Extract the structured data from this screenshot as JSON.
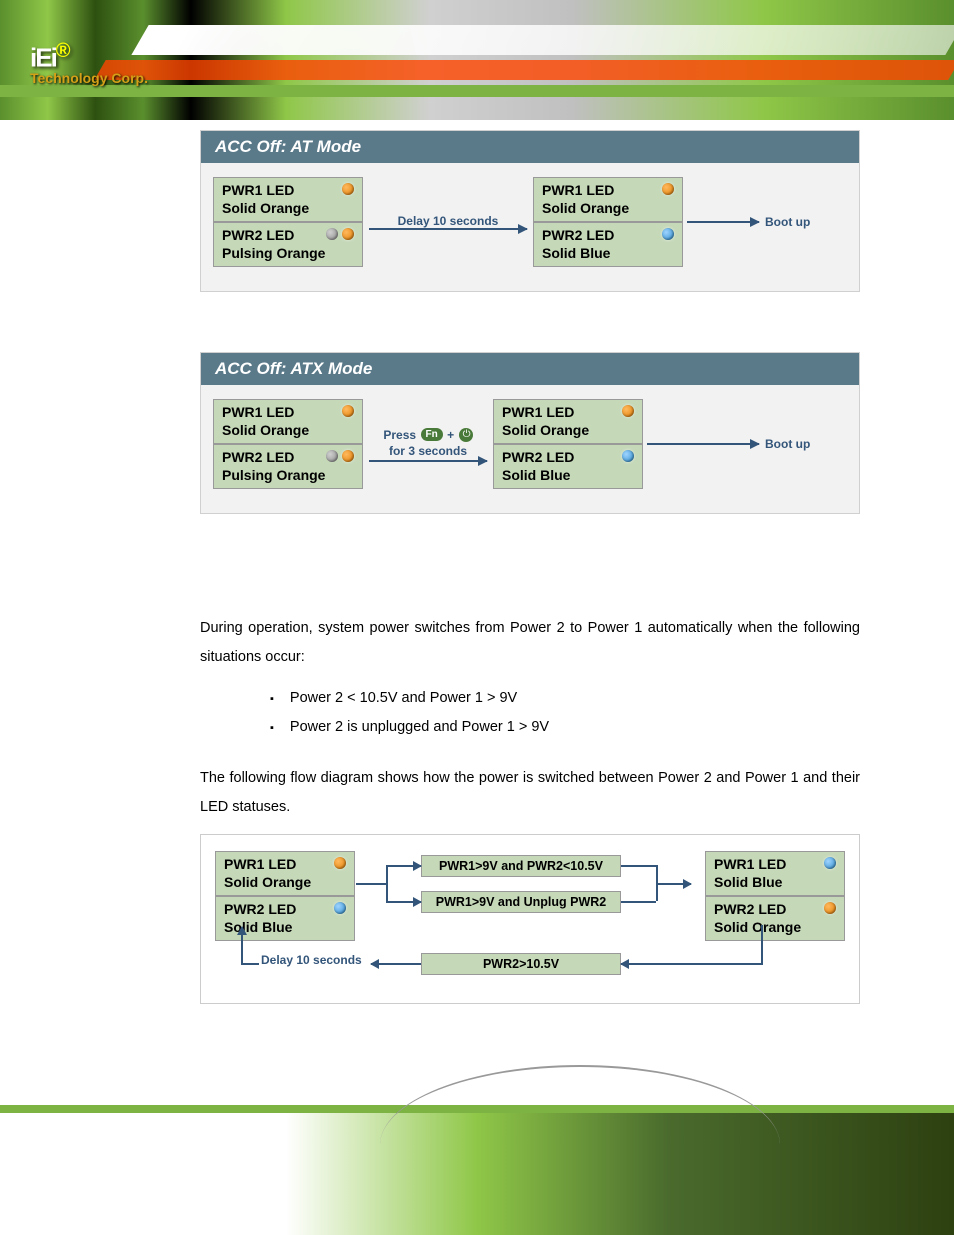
{
  "logo": {
    "main": "iEi",
    "reg": "®",
    "sub": "Technology Corp."
  },
  "diagram1": {
    "title": "ACC Off: AT Mode",
    "left": {
      "row1": "PWR1 LED\nSolid Orange",
      "row2": "PWR2 LED\nPulsing Orange"
    },
    "mid": "Delay 10 seconds",
    "right": {
      "row1": "PWR1 LED\nSolid Orange",
      "row2": "PWR2 LED\nSolid Blue"
    },
    "boot": "Boot up"
  },
  "diagram2": {
    "title": "ACC Off: ATX Mode",
    "left": {
      "row1": "PWR1 LED\nSolid Orange",
      "row2": "PWR2 LED\nPulsing Orange"
    },
    "mid_top": "Press",
    "fn": "Fn",
    "mid_bot": "for 3 seconds",
    "right": {
      "row1": "PWR1 LED\nSolid Orange",
      "row2": "PWR2 LED\nSolid Blue"
    },
    "boot": "Boot up"
  },
  "text": {
    "p1": "During operation, system power switches from Power 2 to Power 1 automatically when the following situations occur:",
    "b1": "Power 2 < 10.5V and Power 1 > 9V",
    "b2": "Power 2 is unplugged and Power 1 > 9V",
    "p2": "The following flow diagram shows how the power is switched between Power 2 and Power 1 and their LED statuses."
  },
  "diagram3": {
    "left": {
      "row1": "PWR1 LED\nSolid Orange",
      "row2": "PWR2 LED\nSolid Blue"
    },
    "right": {
      "row1": "PWR1 LED\nSolid Blue",
      "row2": "PWR2 LED\nSolid Orange"
    },
    "cond1": "PWR1>9V and PWR2<10.5V",
    "cond2": "PWR1>9V and Unplug PWR2",
    "cond3": "PWR2>10.5V",
    "delay": "Delay 10 seconds"
  }
}
